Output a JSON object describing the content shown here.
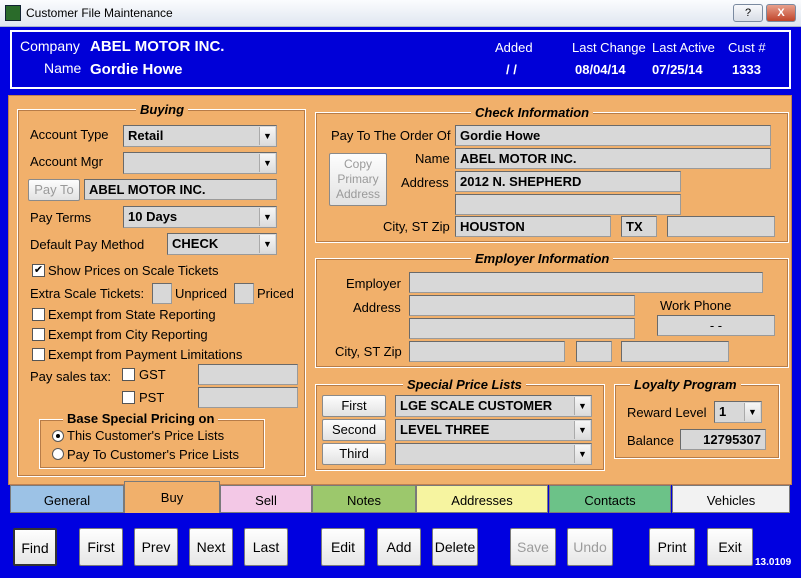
{
  "window": {
    "title": "Customer File Maintenance",
    "help_label": "?",
    "close_label": "X"
  },
  "header": {
    "company_label": "Company",
    "company": "ABEL MOTOR INC.",
    "name_label": "Name",
    "name": "Gordie Howe",
    "added_label": "Added",
    "added": "/  /",
    "last_change_label": "Last Change",
    "last_change": "08/04/14",
    "last_active_label": "Last Active",
    "last_active": "07/25/14",
    "cust_label": "Cust #",
    "cust": "1333"
  },
  "buying": {
    "title": "Buying",
    "account_type_label": "Account Type",
    "account_type": "Retail",
    "account_mgr_label": "Account Mgr",
    "account_mgr": "",
    "pay_to_button": "Pay To",
    "pay_to": "ABEL MOTOR INC.",
    "pay_terms_label": "Pay Terms",
    "pay_terms": "10 Days",
    "default_pay_label": "Default Pay Method",
    "default_pay": "CHECK",
    "show_prices_label": "Show Prices on Scale Tickets",
    "show_prices_checked": true,
    "extra_scale_label": "Extra Scale Tickets:",
    "unpriced_label": "Unpriced",
    "priced_label": "Priced",
    "exempt_state_label": "Exempt from State Reporting",
    "exempt_city_label": "Exempt from City Reporting",
    "exempt_payment_label": "Exempt from Payment Limitations",
    "pay_sales_tax_label": "Pay sales tax:",
    "gst_label": "GST",
    "pst_label": "PST",
    "base_special_title": "Base Special Pricing on",
    "this_customer_label": "This Customer's Price Lists",
    "pay_to_customer_label": "Pay To Customer's Price Lists"
  },
  "check": {
    "title": "Check Information",
    "pay_to_order_label": "Pay To The Order Of",
    "pay_to_order": "Gordie Howe",
    "copy_button": "Copy Primary Address",
    "name_label": "Name",
    "name": "ABEL MOTOR INC.",
    "address_label": "Address",
    "address1": "2012 N. SHEPHERD",
    "address2": "",
    "city_label": "City, ST Zip",
    "city": "HOUSTON",
    "state": "TX",
    "zip": ""
  },
  "employer": {
    "title": "Employer Information",
    "employer_label": "Employer",
    "address_label": "Address",
    "work_phone_label": "Work Phone",
    "work_phone": "-  -",
    "city_label": "City, ST Zip"
  },
  "special_price": {
    "title": "Special Price Lists",
    "first_button": "First",
    "first_value": "LGE SCALE CUSTOMER",
    "second_button": "Second",
    "second_value": "LEVEL THREE",
    "third_button": "Third",
    "third_value": ""
  },
  "loyalty": {
    "title": "Loyalty Program",
    "reward_label": "Reward Level",
    "reward_value": "1",
    "balance_label": "Balance",
    "balance": "12795307"
  },
  "tabs": [
    {
      "label": "General",
      "color": "#9cc2e6"
    },
    {
      "label": "Buy",
      "color": "#f1b06b"
    },
    {
      "label": "Sell",
      "color": "#f3c8e6"
    },
    {
      "label": "Notes",
      "color": "#9cc86c"
    },
    {
      "label": "Addresses",
      "color": "#f6f4a0"
    },
    {
      "label": "Contacts",
      "color": "#6cc288"
    },
    {
      "label": "Vehicles",
      "color": "#f2f2f2"
    }
  ],
  "buttons": {
    "find": "Find",
    "first": "First",
    "prev": "Prev",
    "next": "Next",
    "last": "Last",
    "edit": "Edit",
    "add": "Add",
    "delete": "Delete",
    "save": "Save",
    "undo": "Undo",
    "print": "Print",
    "exit": "Exit"
  },
  "version": "13.0109"
}
